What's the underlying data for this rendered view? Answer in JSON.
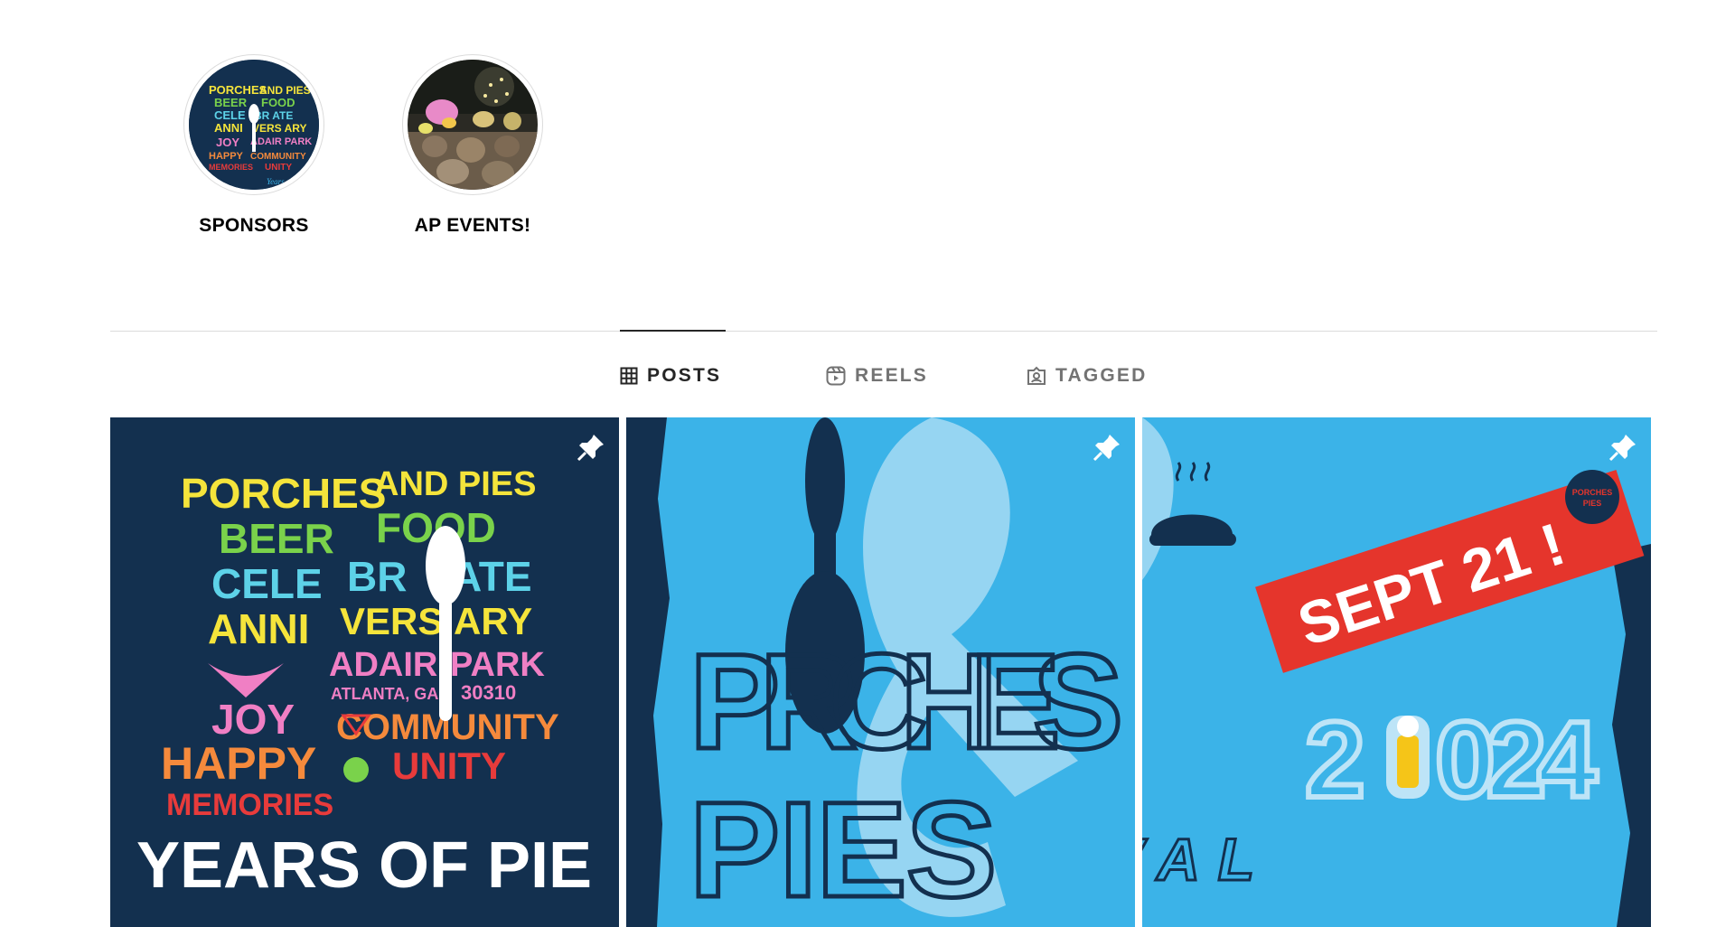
{
  "highlights": [
    {
      "label": "SPONSORS"
    },
    {
      "label": "AP EVENTS!"
    }
  ],
  "tabs": [
    {
      "label": "POSTS",
      "icon": "grid-icon",
      "active": true
    },
    {
      "label": "REELS",
      "icon": "reels-icon",
      "active": false
    },
    {
      "label": "TAGGED",
      "icon": "tagged-icon",
      "active": false
    }
  ],
  "posts": [
    {
      "pinned": true,
      "artwork": {
        "words_left": [
          "PORCHES",
          "BEER",
          "CELE",
          "ANNI",
          "JOY",
          "HAPPY",
          "MEMORIES"
        ],
        "words_right": [
          "AND PIES",
          "FOOD",
          "BR",
          "ATE",
          "VERS",
          "ARY",
          "ADAIR",
          "PARK",
          "ATLANTA, GA",
          "30310",
          "COMMUNITY",
          "UNITY"
        ],
        "footer": "YEARS OF PIE"
      }
    },
    {
      "pinned": true,
      "artwork": {
        "title_line1": "P RCHES",
        "title_line2": "PIES"
      }
    },
    {
      "pinned": true,
      "artwork": {
        "banner": "SEPT 21 !",
        "year_a": "2",
        "year_b": "024",
        "festival": "FESTIVAL",
        "badge_line1": "PORCHES",
        "badge_line2": "PIES"
      }
    }
  ],
  "colors": {
    "accent_blue": "#3bb3e8",
    "navy": "#13304f",
    "banner_red": "#e5352c"
  }
}
